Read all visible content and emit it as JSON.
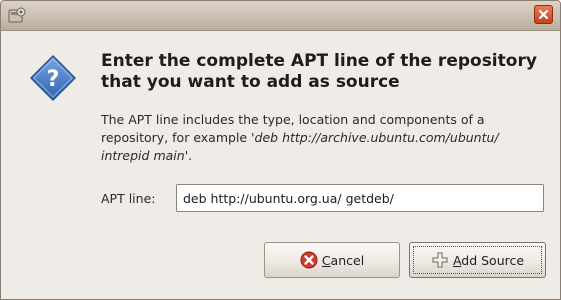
{
  "window": {
    "app_icon": "repository-dialog-icon",
    "close_icon": "close-icon"
  },
  "dialog": {
    "icon": "question-icon",
    "heading": "Enter the complete APT line of the repository that you want to add as source",
    "description_plain": "The APT line includes the type, location and components of a repository, for example  '",
    "description_example": "deb http://archive.ubuntu.com/ubuntu/ intrepid main",
    "description_end": "'.",
    "apt_line_label": "APT line:",
    "apt_line_value": "deb http://ubuntu.org.ua/ getdeb/"
  },
  "buttons": {
    "cancel": {
      "label": "Cancel",
      "mnemonic": "C",
      "rest": "ancel",
      "icon": "cancel-icon"
    },
    "add": {
      "label": "Add Source",
      "mnemonic": "A",
      "rest": "dd Source",
      "icon": "add-icon"
    }
  },
  "colors": {
    "window_bg": "#efebe7",
    "titlebar": "#cbbfb1",
    "close_button": "#d8582a",
    "question_icon": "#3f77c4"
  }
}
